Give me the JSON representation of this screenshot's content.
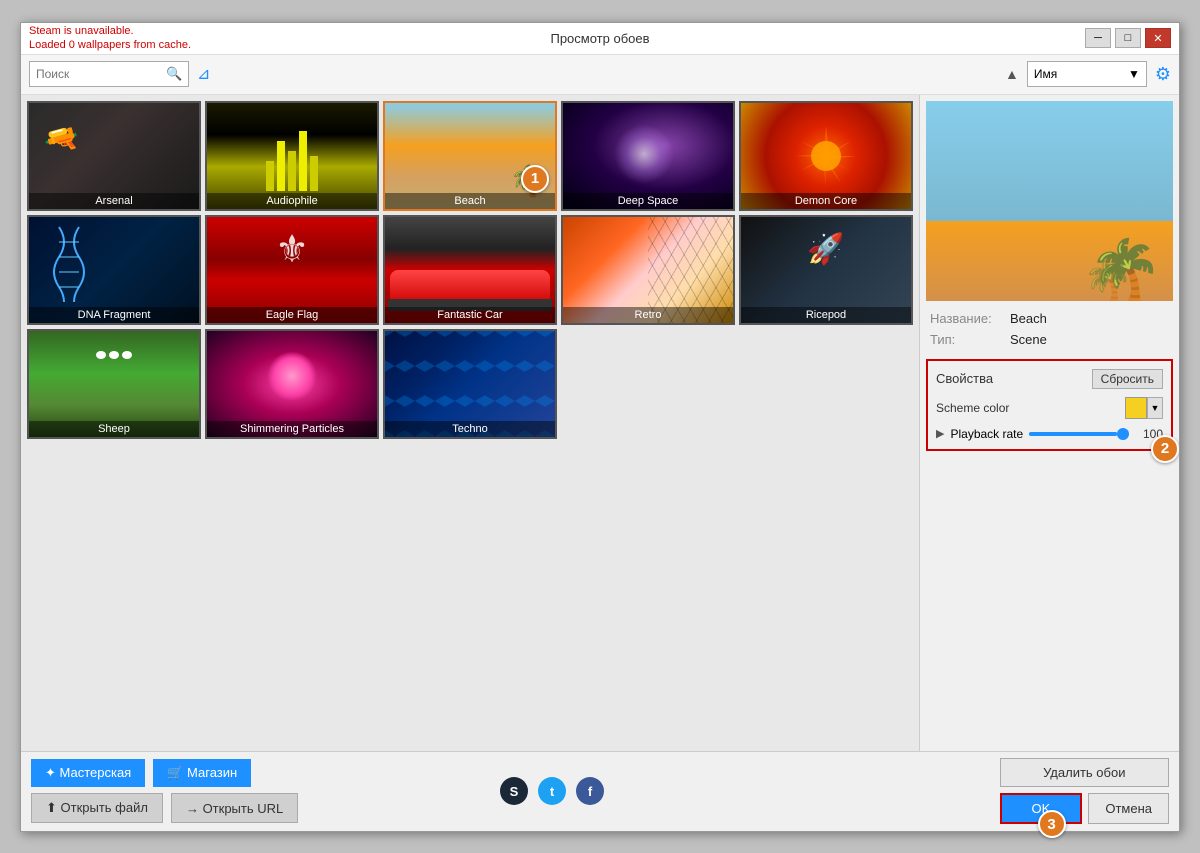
{
  "window": {
    "title": "Просмотр обоев",
    "error_line1": "Steam is unavailable.",
    "error_line2": "Loaded 0 wallpapers from cache."
  },
  "toolbar": {
    "search_placeholder": "Поиск",
    "sort_label": "Имя"
  },
  "gallery": {
    "items": [
      {
        "id": "arsenal",
        "label": "Arsenal",
        "bg_class": "bg-arsenal",
        "selected": false
      },
      {
        "id": "audiophile",
        "label": "Audiophile",
        "bg_class": "bg-audiophile",
        "selected": false
      },
      {
        "id": "beach",
        "label": "Beach",
        "bg_class": "bg-beach",
        "selected": true
      },
      {
        "id": "deepspace",
        "label": "Deep Space",
        "bg_class": "bg-deepspace",
        "selected": false
      },
      {
        "id": "demoncore",
        "label": "Demon Core",
        "bg_class": "bg-demoncore",
        "selected": false
      },
      {
        "id": "dna",
        "label": "DNA Fragment",
        "bg_class": "bg-dna",
        "selected": false
      },
      {
        "id": "eagleflag",
        "label": "Eagle Flag",
        "bg_class": "bg-eagleflag",
        "selected": false
      },
      {
        "id": "fantasticcar",
        "label": "Fantastic Car",
        "bg_class": "bg-fantasticcar",
        "selected": false
      },
      {
        "id": "retro",
        "label": "Retro",
        "bg_class": "bg-retro",
        "selected": false
      },
      {
        "id": "ricepod",
        "label": "Ricepod",
        "bg_class": "bg-ricepod",
        "selected": false
      },
      {
        "id": "sheep",
        "label": "Sheep",
        "bg_class": "bg-sheep",
        "selected": false
      },
      {
        "id": "shimmering",
        "label": "Shimmering Particles",
        "bg_class": "bg-shimmering",
        "selected": false
      },
      {
        "id": "techno",
        "label": "Techno",
        "bg_class": "bg-techno",
        "selected": false
      }
    ]
  },
  "side_panel": {
    "name_label": "Название:",
    "name_value": "Beach",
    "type_label": "Тип:",
    "type_value": "Scene",
    "properties": {
      "title": "Свойства",
      "reset_label": "Сбросить",
      "scheme_color_label": "Scheme color",
      "playback_label": "Playback rate",
      "playback_value": "100"
    }
  },
  "bottom_bar": {
    "workshop_label": "✦ Мастерская",
    "shop_label": "🛒 Магазин",
    "open_file_label": "⬆ Открыть файл",
    "open_url_label": "→ Открыть URL",
    "delete_label": "Удалить обои",
    "ok_label": "OK",
    "cancel_label": "Отмена"
  },
  "badges": {
    "badge1": "1",
    "badge2": "2",
    "badge3": "3"
  }
}
